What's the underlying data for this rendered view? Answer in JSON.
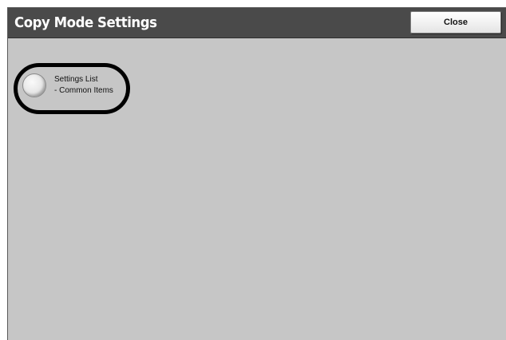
{
  "header": {
    "title": "Copy Mode Settings",
    "close_label": "Close"
  },
  "options": [
    {
      "line1": "Settings List",
      "line2": "- Common Items",
      "selected": false
    }
  ]
}
